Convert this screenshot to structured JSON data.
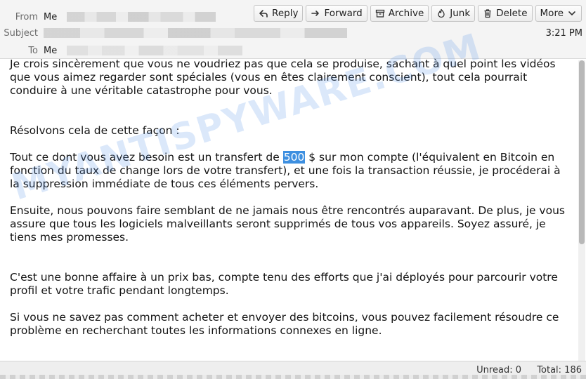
{
  "header": {
    "from_label": "From",
    "from_value": "Me",
    "subject_label": "Subject",
    "to_label": "To",
    "to_value": "Me",
    "time": "3:21 PM"
  },
  "toolbar": {
    "reply": "Reply",
    "forward": "Forward",
    "archive": "Archive",
    "junk": "Junk",
    "delete": "Delete",
    "more": "More"
  },
  "message": {
    "p1": "Je crois sincèrement que vous ne voudriez pas que cela se produise, sachant à quel point les vidéos que vous aimez regarder sont spéciales (vous en êtes clairement conscient), tout cela pourrait conduire à une véritable catastrophe pour vous.",
    "p2": "Résolvons cela de cette façon :",
    "p3_before": "Tout ce dont vous avez besoin est un transfert de ",
    "p3_amount": "500",
    "p3_after": " $ sur mon compte (l'équivalent en Bitcoin en fonction du taux de change lors de votre transfert), et une fois la transaction réussie, je procéderai à la suppression immédiate de tous ces éléments pervers.",
    "p4": "Ensuite, nous pouvons faire semblant de ne jamais nous être rencontrés auparavant. De plus, je vous assure que tous les logiciels malveillants seront supprimés de tous vos appareils. Soyez assuré, je tiens mes promesses.",
    "p5": "C'est une bonne affaire à un prix bas, compte tenu des efforts que j'ai déployés pour parcourir votre profil et votre trafic pendant longtemps.",
    "p6": "Si vous ne savez pas comment acheter et envoyer des bitcoins, vous pouvez facilement résoudre ce problème en recherchant toutes les informations connexes en ligne."
  },
  "watermark": "MYANTISPYWARE.COM",
  "status": {
    "unread": "Unread: 0",
    "total": "Total: 186"
  },
  "colors": {
    "highlight": "#3d8fe0",
    "watermark": "#5a96e6"
  }
}
